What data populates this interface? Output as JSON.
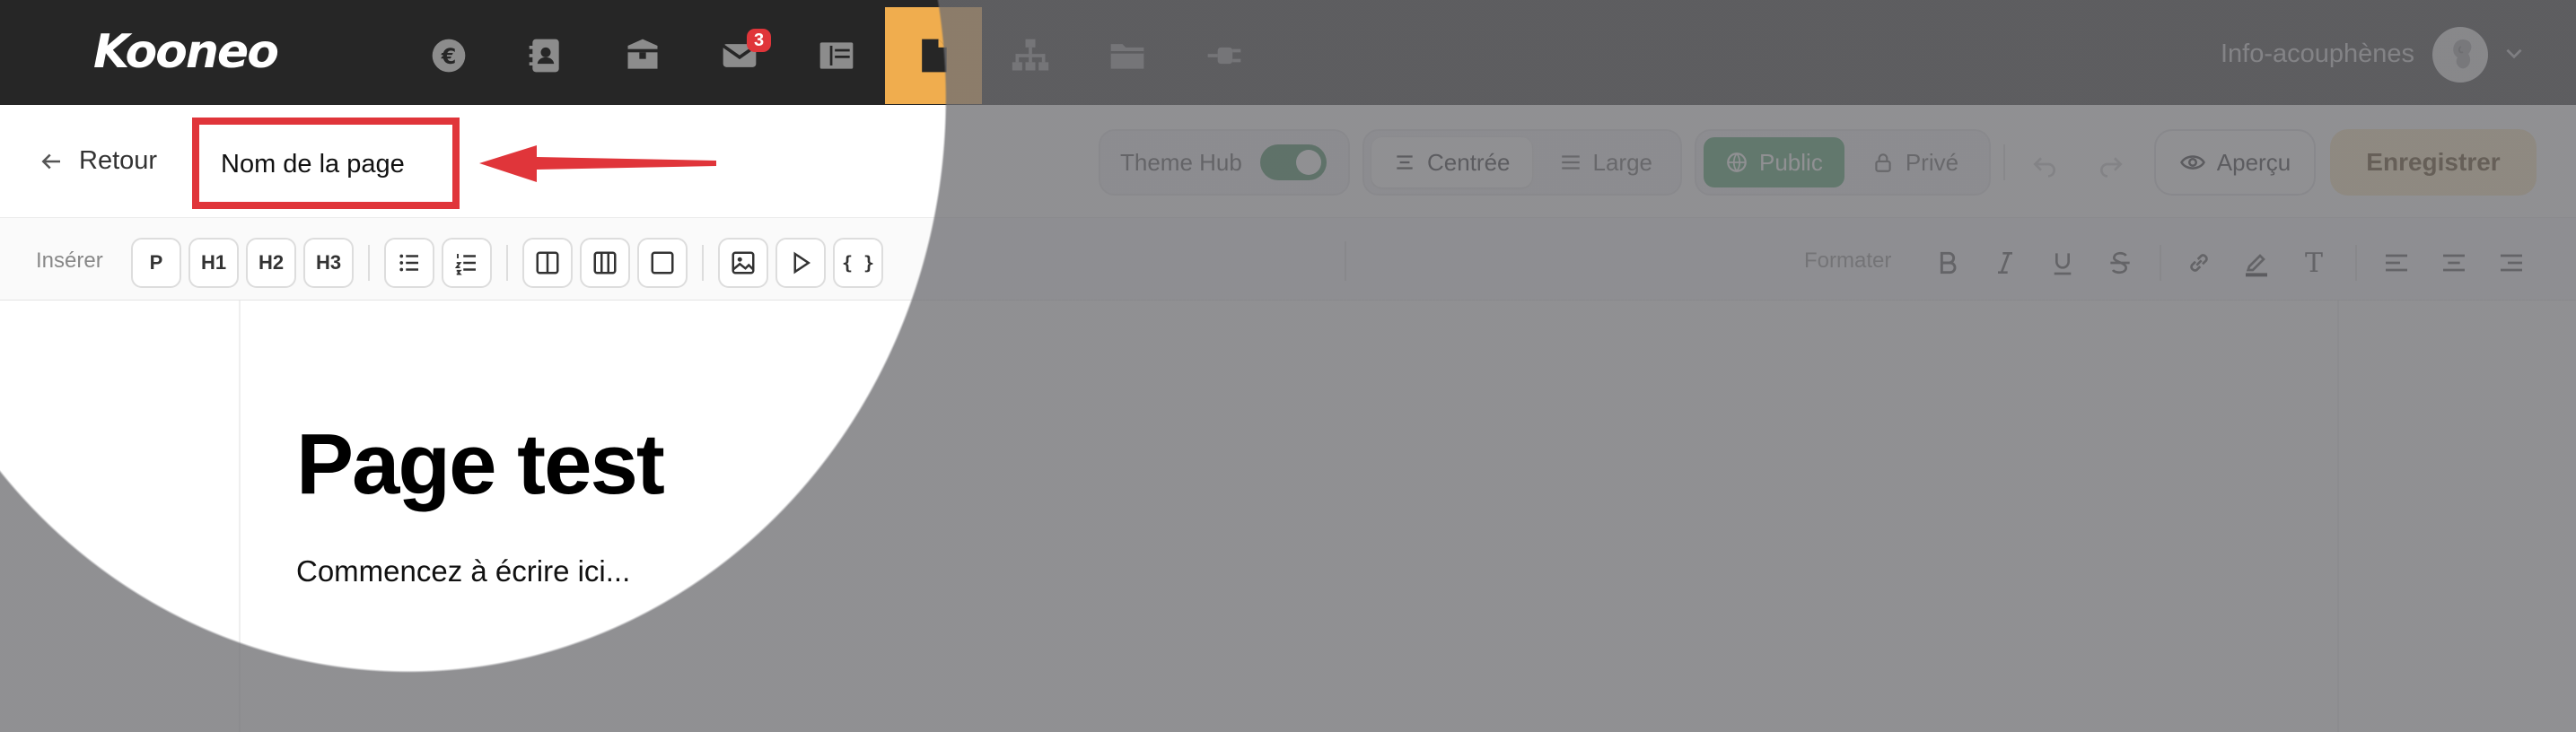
{
  "app": {
    "logo": "Kooneo",
    "nav_icons": [
      {
        "name": "euro-icon"
      },
      {
        "name": "contacts-icon"
      },
      {
        "name": "package-icon"
      },
      {
        "name": "mail-icon",
        "badge": "3"
      },
      {
        "name": "layout-icon"
      },
      {
        "name": "page-icon",
        "active": true
      },
      {
        "name": "sitemap-icon"
      },
      {
        "name": "folder-icon"
      },
      {
        "name": "plug-icon"
      }
    ],
    "user": {
      "name": "Info-acouphènes"
    }
  },
  "header": {
    "back_label": "Retour",
    "page_name_value": "Nom de la page",
    "theme_hub_label": "Theme Hub",
    "theme_hub_on": true,
    "layout_options": [
      "Centrée",
      "Large"
    ],
    "layout_selected": "Centrée",
    "visibility_options": [
      "Public",
      "Privé"
    ],
    "visibility_selected": "Public",
    "preview_label": "Aperçu",
    "save_label": "Enregistrer"
  },
  "toolbar": {
    "insert_label": "Insérer",
    "insert_buttons": [
      "P",
      "H1",
      "H2",
      "H3"
    ],
    "code_glyph": "{ }",
    "format_label": "Formater",
    "format_glyph_text": "T"
  },
  "content": {
    "title": "Page test",
    "body": "Commencez à écrire ici..."
  },
  "colors": {
    "topbar": "#262626",
    "active_nav": "#f0ad4e",
    "badge": "#e0353a",
    "annotation": "#e0353a",
    "toggle": "#2e7d4a",
    "public_green": "#3a9b5c",
    "save_button": "#fbe4b2"
  }
}
